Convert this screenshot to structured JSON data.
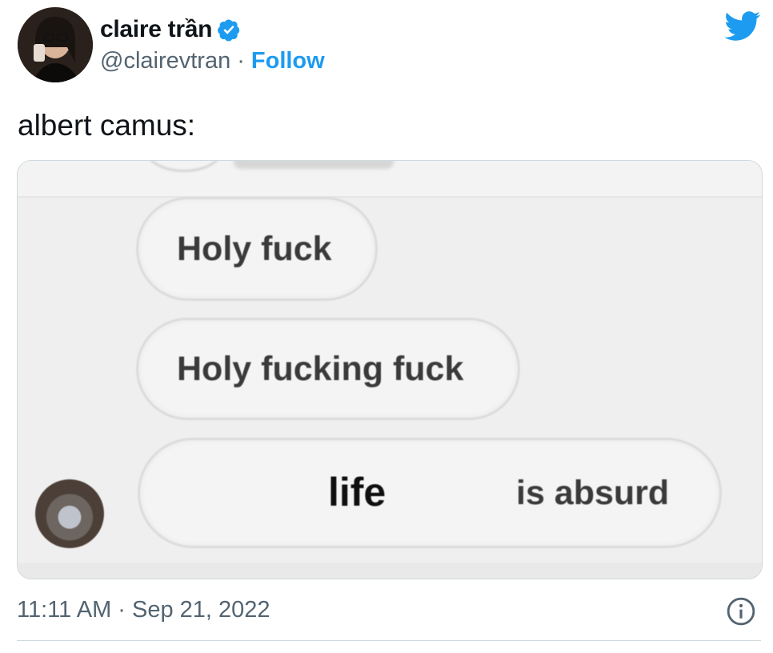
{
  "author": {
    "display_name": "claire trần",
    "handle": "@clairevtran",
    "separator": "·",
    "follow_label": "Follow",
    "avatar_icon": "profile-photo",
    "verified_icon": "verified-badge-icon"
  },
  "brand": {
    "logo_icon": "twitter-bird-icon",
    "accent": "#1d9bf0"
  },
  "tweet": {
    "text": "albert camus:",
    "timestamp": "11:11 AM · Sep 21, 2022",
    "info_icon": "info-icon"
  },
  "media": {
    "bubbles": [
      {
        "text": "Holy fuck"
      },
      {
        "text": "Holy fucking fuck"
      }
    ],
    "last_bubble": {
      "word": "life",
      "rest": "is absurd"
    }
  },
  "colors": {
    "text": "#0f1419",
    "secondary": "#536471",
    "border": "#cfd9de"
  }
}
